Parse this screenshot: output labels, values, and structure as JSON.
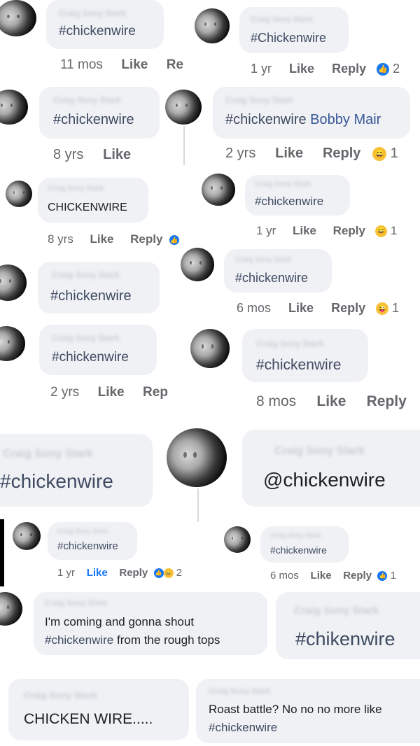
{
  "comments": [
    {
      "text": "#chickenwire",
      "time": "11 mos",
      "like": "Like",
      "reply": "Re"
    },
    {
      "text": "#Chickenwire",
      "time": "1 yr",
      "like": "Like",
      "reply": "Reply",
      "count": "2"
    },
    {
      "text": "#chickenwire",
      "time": "8 yrs",
      "like": "Like"
    },
    {
      "text": "#chickenwire",
      "mention": "Bobby Mair",
      "time": "2 yrs",
      "like": "Like",
      "reply": "Reply",
      "count": "1"
    },
    {
      "text": "CHICKENWIRE",
      "time": "8 yrs",
      "like": "Like",
      "reply": "Reply"
    },
    {
      "text": "#chickenwire",
      "time": "1 yr",
      "like": "Like",
      "reply": "Reply",
      "count": "1"
    },
    {
      "text": "#chickenwire"
    },
    {
      "text": "#chickenwire",
      "time": "6 mos",
      "like": "Like",
      "reply": "Reply",
      "count": "1"
    },
    {
      "text": "#chickenwire",
      "time": "2 yrs",
      "like": "Like",
      "reply": "Rep"
    },
    {
      "text": "#chickenwire",
      "time": "8 mos",
      "like": "Like",
      "reply": "Reply"
    },
    {
      "text": "#chickenwire"
    },
    {
      "text": "@chickenwire"
    },
    {
      "text": "#chickenwire",
      "time": "1 yr",
      "like": "Like",
      "reply": "Reply",
      "count": "2"
    },
    {
      "text": "#chickenwire",
      "time": "6 mos",
      "like": "Like",
      "reply": "Reply",
      "count": "1"
    },
    {
      "line1": "I'm coming and gonna shout",
      "line2_tag": "#chickenwire",
      "line2_rest": " from the rough tops"
    },
    {
      "text": "#chikenwire"
    },
    {
      "text": "CHICKEN WIRE....."
    },
    {
      "line1": "Roast battle? No no no more like",
      "line2_tag": "#chickenwire"
    }
  ],
  "blurred_name": "Craig Sony Stark",
  "icons": {
    "like": "like-reaction-icon",
    "haha": "haha-reaction-icon",
    "wow": "laugh-tongue-reaction-icon"
  },
  "colors": {
    "bubble": "#eff1f4",
    "meta": "#65676b",
    "link": "#385898",
    "like_blue": "#1877f2"
  }
}
